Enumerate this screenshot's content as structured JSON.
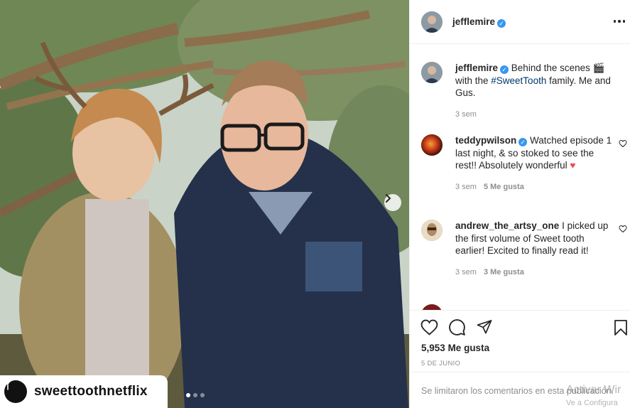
{
  "post": {
    "author": "jefflemire",
    "likes_count": "5,953",
    "likes_label": "Me gusta",
    "date": "5 DE JUNIO",
    "comments_limited": "Se limitaron los comentarios en esta publicación."
  },
  "media": {
    "watermark": "sweettoothnetflix"
  },
  "caption": {
    "username": "jefflemire",
    "text_before": "Behind the scenes 🎬 with the ",
    "hashtag": "#SweetTooth",
    "text_after": " family. Me and Gus.",
    "time": "3 sem"
  },
  "comments": [
    {
      "username": "teddypwilson",
      "verified": true,
      "text": "Watched episode 1 last night, & so stoked to see the rest!! Absolutely wonderful",
      "emoji": "♥",
      "time": "3 sem",
      "likes": "5 Me gusta"
    },
    {
      "username": "andrew_the_artsy_one",
      "verified": false,
      "text": "I picked up the first volume of Sweet tooth earlier! Excited to finally read it!",
      "time": "3 sem",
      "likes": "3 Me gusta"
    }
  ],
  "windows_overlay": {
    "line1": "Activar Wir",
    "line2": "Ve a Configura"
  },
  "icons": {
    "like": "heart-icon",
    "comment": "comment-icon",
    "share": "paper-plane-icon",
    "save": "bookmark-icon",
    "more": "more-options-icon",
    "next": "chevron-right-icon"
  },
  "colors": {
    "verified": "#3897f0",
    "hashtag": "#00376b",
    "secondary_text": "#8e8e8e",
    "heart_red": "#ed4956"
  }
}
